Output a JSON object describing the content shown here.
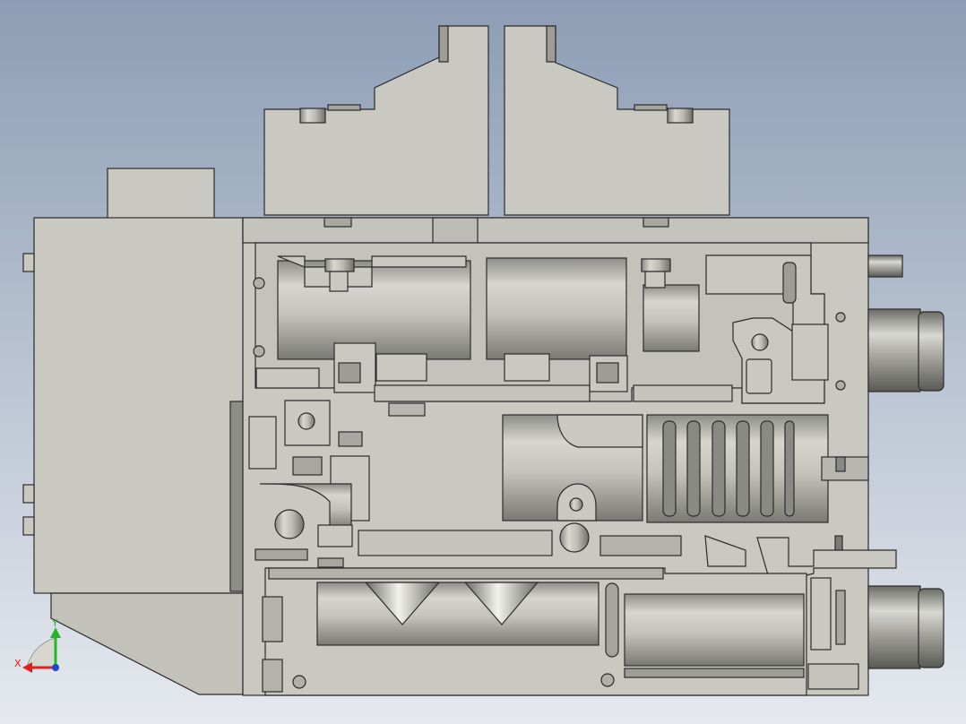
{
  "viewport": {
    "background_top": "#8c9db5",
    "background_bottom": "#e6e9ef",
    "body_fill": "#c9c9c1",
    "shadow_fill": "#9d9d96",
    "edge_color": "#2b2b2b",
    "cut_fill": "#b3b3ab"
  },
  "triad": {
    "x_label": "X",
    "y_label": "Y",
    "x_color": "#e0201c",
    "y_color": "#22b822",
    "z_color": "#2343d8"
  }
}
